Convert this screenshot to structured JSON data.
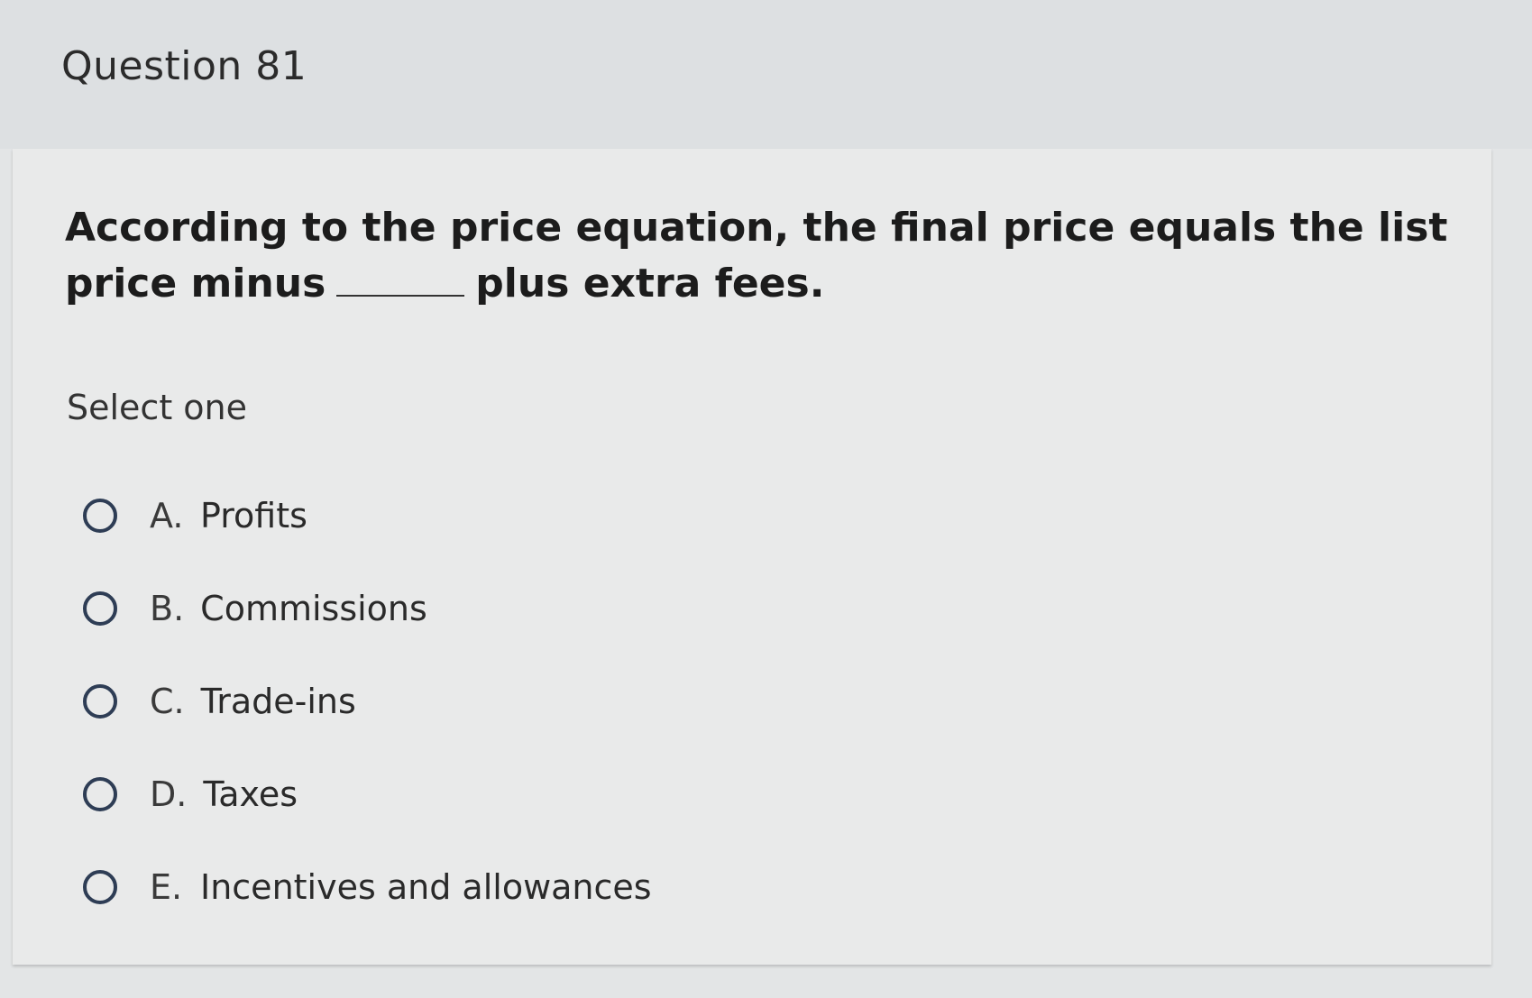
{
  "header": {
    "title": "Question 81"
  },
  "question": {
    "text_before_blank": "According to the price equation, the final price equals the list price minus",
    "text_after_blank": "plus extra fees."
  },
  "instruction": "Select one",
  "options": [
    {
      "letter": "A.",
      "label": "Profits"
    },
    {
      "letter": "B.",
      "label": "Commissions"
    },
    {
      "letter": "C.",
      "label": "Trade-ins"
    },
    {
      "letter": "D.",
      "label": "Taxes"
    },
    {
      "letter": "E.",
      "label": "Incentives and allowances"
    }
  ],
  "colors": {
    "radio_border": "#2e3d55",
    "background": "#e9eaea"
  }
}
